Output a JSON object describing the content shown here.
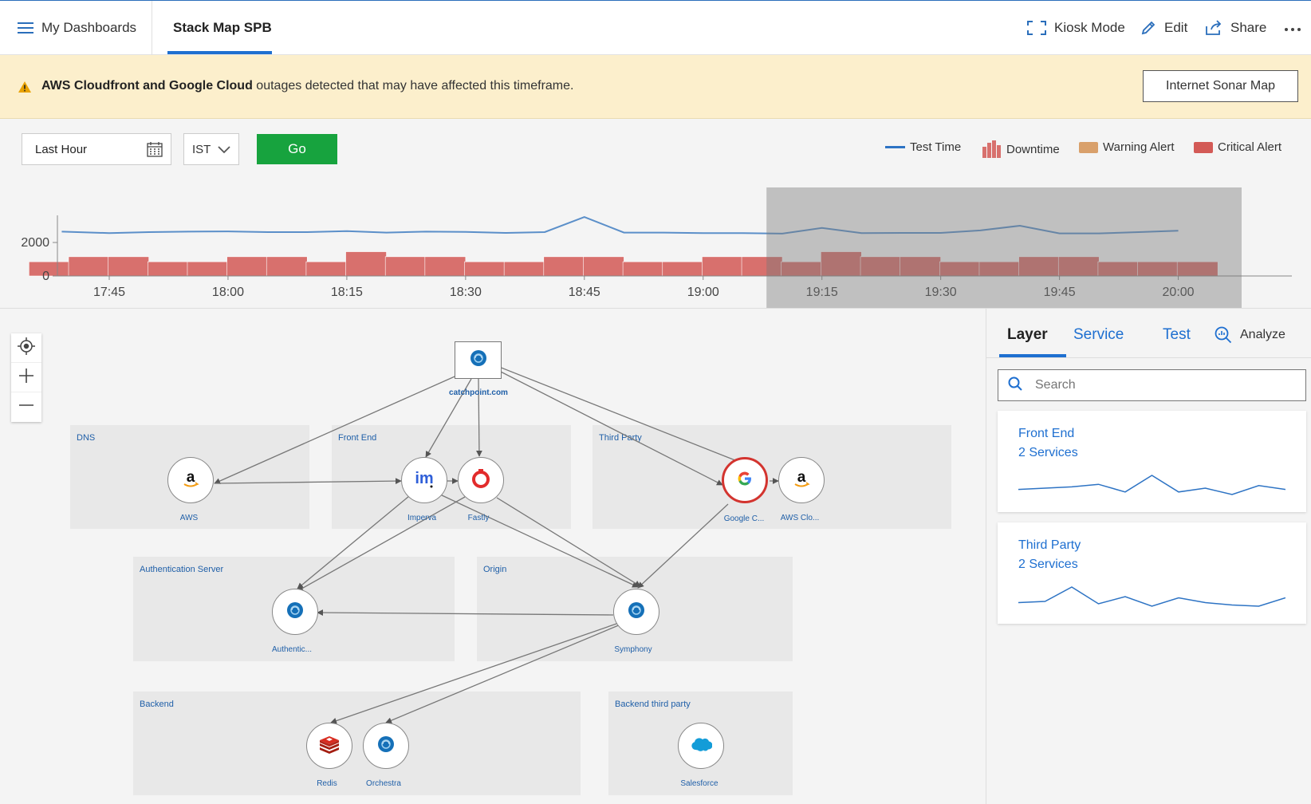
{
  "header": {
    "dashboards_label": "My Dashboards",
    "tab_label": "Stack Map SPB",
    "kiosk_label": "Kiosk Mode",
    "edit_label": "Edit",
    "share_label": "Share",
    "more_icon": "more-icon"
  },
  "banner": {
    "bold_text": "AWS Cloudfront and Google Cloud",
    "rest_text": " outages detected that may have affected this timeframe.",
    "button_label": "Internet Sonar Map"
  },
  "controls": {
    "range_value": "Last Hour",
    "timezone": "IST",
    "go_label": "Go"
  },
  "legend": [
    {
      "label": "Test Time",
      "color": "#2d73c4"
    },
    {
      "label": "Downtime",
      "color": "#d8706d"
    },
    {
      "label": "Warning Alert",
      "color": "#d9a06b"
    },
    {
      "label": "Critical Alert",
      "color": "#d35a56"
    }
  ],
  "chart_data": {
    "type": "bar",
    "x_ticks": [
      "17:45",
      "18:00",
      "18:15",
      "18:30",
      "18:45",
      "19:00",
      "19:15",
      "19:30",
      "19:45",
      "20:00"
    ],
    "y_ticks": [
      0,
      2000
    ],
    "ylim": [
      0,
      4000
    ],
    "selection": {
      "from": "19:08",
      "to": "20:08"
    },
    "series": [
      {
        "name": "Test Time",
        "kind": "line",
        "color": "#5b8fc9",
        "x": [
          "17:39",
          "17:45",
          "17:50",
          "17:55",
          "18:00",
          "18:05",
          "18:10",
          "18:15",
          "18:20",
          "18:25",
          "18:30",
          "18:35",
          "18:40",
          "18:45",
          "18:50",
          "18:55",
          "19:00",
          "19:05",
          "19:10",
          "19:15",
          "19:20",
          "19:25",
          "19:30",
          "19:35",
          "19:40",
          "19:45",
          "19:50",
          "19:55",
          "20:00"
        ],
        "values": [
          2650,
          2560,
          2620,
          2650,
          2660,
          2620,
          2620,
          2680,
          2590,
          2650,
          2630,
          2570,
          2620,
          3520,
          2590,
          2590,
          2560,
          2560,
          2530,
          2870,
          2560,
          2570,
          2570,
          2720,
          3000,
          2540,
          2540,
          2620,
          2700
        ]
      },
      {
        "name": "Downtime",
        "kind": "bar",
        "color": "#d8706d",
        "x": [
          "17:40",
          "17:45",
          "17:50",
          "17:55",
          "18:00",
          "18:05",
          "18:10",
          "18:15",
          "18:20",
          "18:25",
          "18:30",
          "18:35",
          "18:40",
          "18:45",
          "18:50",
          "18:55",
          "19:00",
          "19:05",
          "19:10",
          "19:15",
          "19:20",
          "19:25",
          "19:30",
          "19:35",
          "19:40",
          "19:45",
          "19:50",
          "19:55",
          "20:00",
          "20:05"
        ],
        "values": [
          850,
          1150,
          1150,
          850,
          850,
          1150,
          1150,
          850,
          1450,
          1150,
          1150,
          850,
          850,
          1150,
          1150,
          850,
          850,
          1150,
          1150,
          850,
          1450,
          1150,
          1150,
          850,
          850,
          1150,
          1150,
          850,
          850,
          850
        ]
      }
    ]
  },
  "map": {
    "zoom_controls": [
      "locate-icon",
      "zoom-in-icon",
      "zoom-out-icon"
    ],
    "root": {
      "label": "catchpoint.com"
    },
    "groups": [
      {
        "key": "dns",
        "label": "DNS"
      },
      {
        "key": "frontend",
        "label": "Front End"
      },
      {
        "key": "thirdparty",
        "label": "Third Party"
      },
      {
        "key": "auth",
        "label": "Authentication Server"
      },
      {
        "key": "origin",
        "label": "Origin"
      },
      {
        "key": "backend",
        "label": "Backend"
      },
      {
        "key": "backend3p",
        "label": "Backend third party"
      }
    ],
    "nodes": [
      {
        "key": "aws",
        "label": "AWS",
        "icon": "amazon-icon"
      },
      {
        "key": "imperva",
        "label": "Imperva",
        "icon": "imperva-icon"
      },
      {
        "key": "fastly",
        "label": "Fastly",
        "icon": "fastly-icon"
      },
      {
        "key": "google",
        "label": "Google C...",
        "icon": "google-icon",
        "status": "critical"
      },
      {
        "key": "awscloud",
        "label": "AWS Clo...",
        "icon": "amazon-icon"
      },
      {
        "key": "auth",
        "label": "Authentic...",
        "icon": "catchpoint-icon"
      },
      {
        "key": "symphony",
        "label": "Symphony",
        "icon": "catchpoint-icon"
      },
      {
        "key": "redis",
        "label": "Redis",
        "icon": "redis-icon"
      },
      {
        "key": "orchestra",
        "label": "Orchestra",
        "icon": "catchpoint-icon"
      },
      {
        "key": "salesforce",
        "label": "Salesforce",
        "icon": "salesforce-icon"
      }
    ]
  },
  "panel": {
    "tabs": [
      "Layer",
      "Service",
      "Test"
    ],
    "analyze_label": "Analyze",
    "search_placeholder": "Search",
    "cards": [
      {
        "title": "Front End",
        "subtitle": "2 Services",
        "trend": [
          4,
          5,
          6,
          8,
          2,
          15,
          2,
          5,
          0,
          7,
          4
        ]
      },
      {
        "title": "Third Party",
        "subtitle": "2 Services",
        "trend": [
          3,
          4,
          16,
          2,
          8,
          0,
          7,
          3,
          1,
          0,
          7
        ]
      }
    ]
  }
}
